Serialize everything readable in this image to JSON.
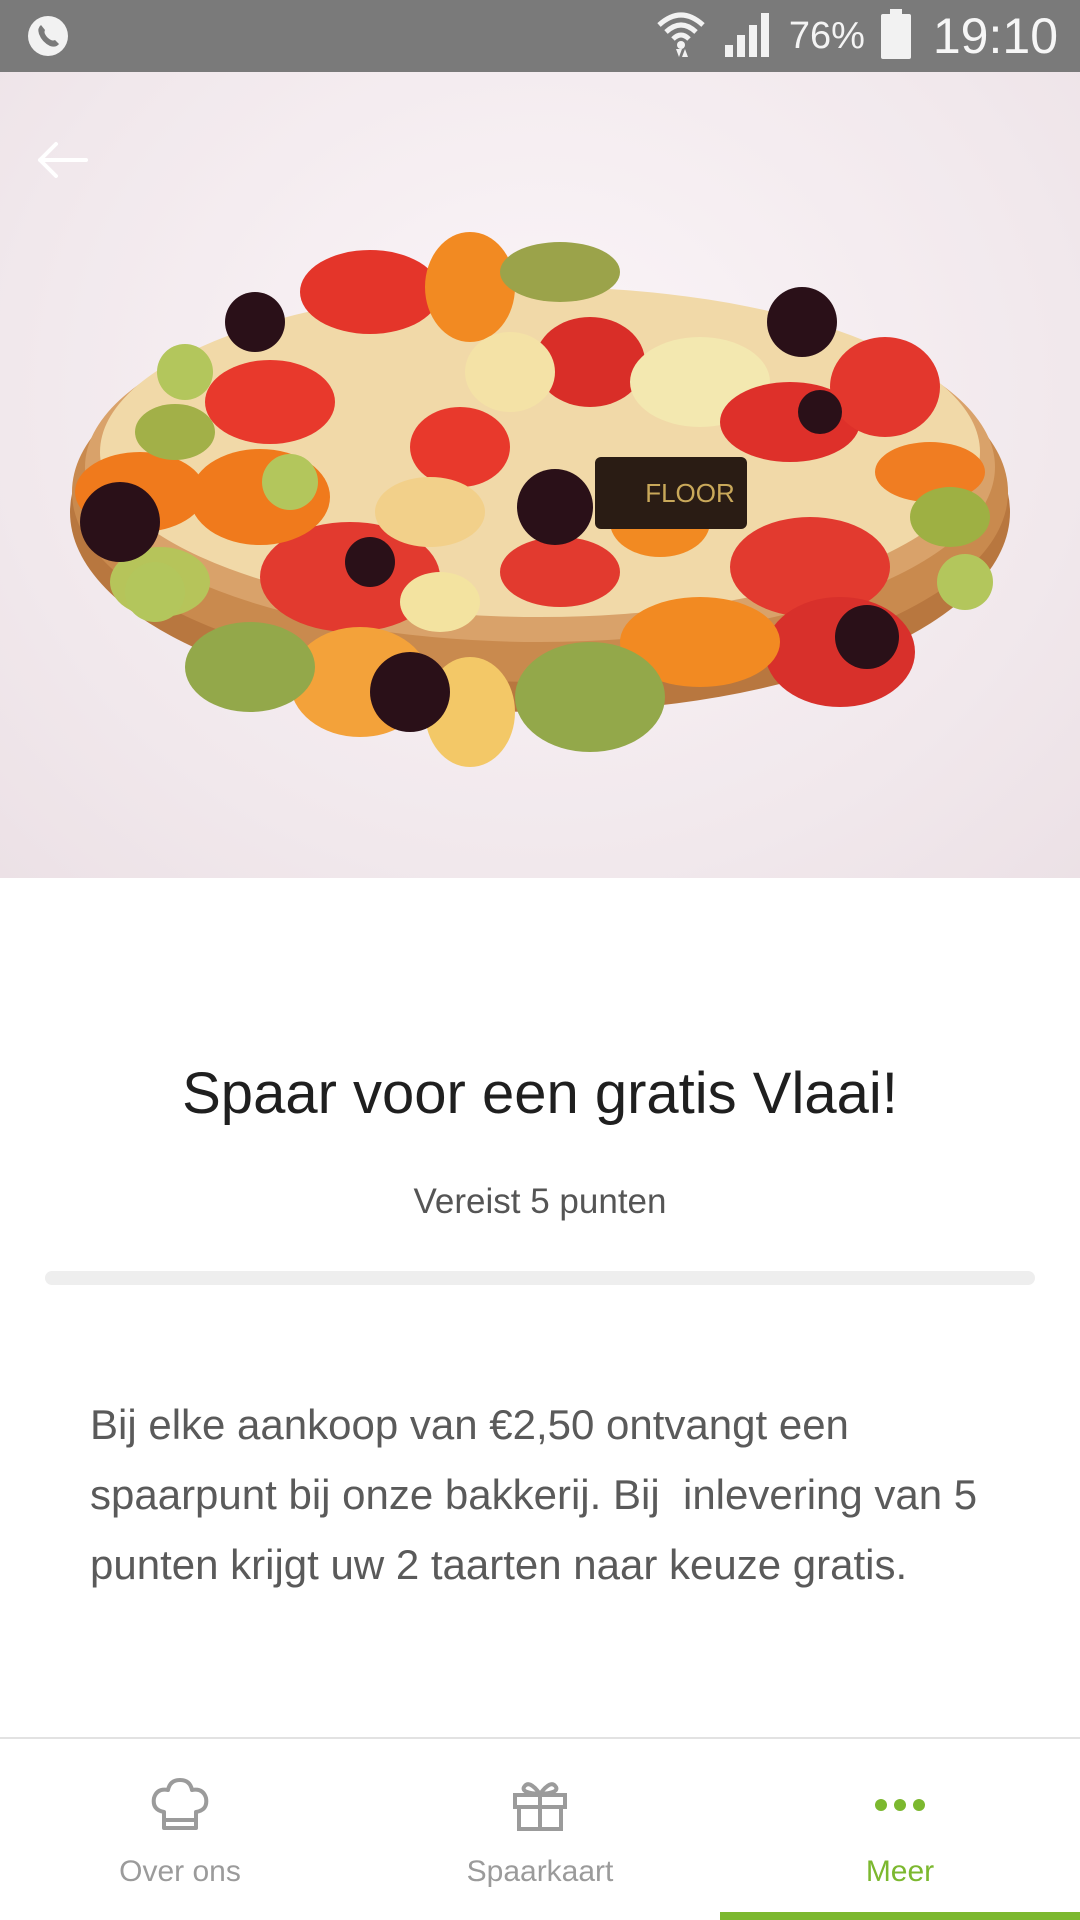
{
  "status_bar": {
    "left_icon": "phone-call-icon",
    "battery_percent": "76%",
    "time": "19:10"
  },
  "hero": {
    "image": "fruit-tart-photo",
    "logo_text": "FLOOR",
    "back_icon": "arrow-left-icon"
  },
  "reward": {
    "title": "Spaar voor een gratis Vlaai!",
    "requirement": "Vereist 5 punten",
    "progress_percent": 0,
    "description": "Bij elke aankoop van €2,50 ontvangt een spaarpunt bij onze bakkerij. Bij  inlevering van 5 punten krijgt uw 2 taarten naar keuze gratis."
  },
  "bottom_nav": {
    "items": [
      {
        "label": "Over ons",
        "icon": "chef-hat-icon"
      },
      {
        "label": "Spaarkaart",
        "icon": "gift-icon"
      },
      {
        "label": "Meer",
        "icon": "more-dots-icon"
      }
    ],
    "active_index": 2
  },
  "colors": {
    "accent": "#7cb82f",
    "status_bar": "#7a7a7a",
    "text_dark": "#1f1f1f",
    "text_muted": "#5a5a5a",
    "nav_inactive": "#9b9b9b"
  }
}
